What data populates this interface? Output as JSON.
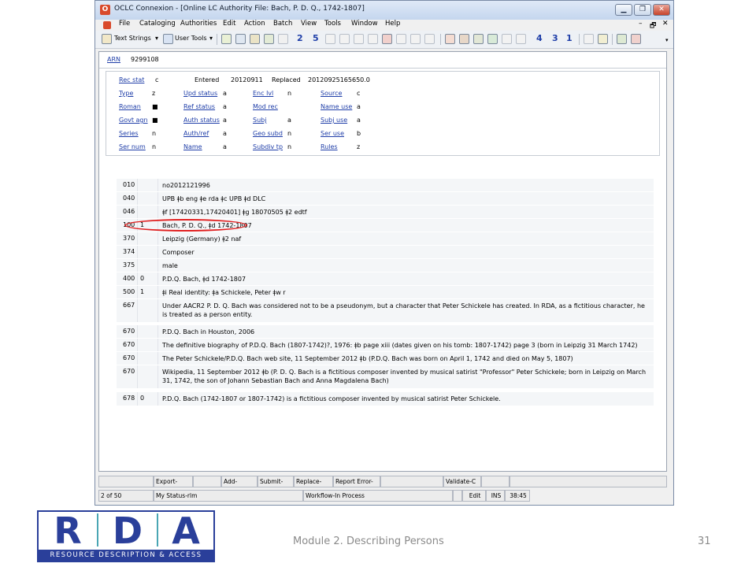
{
  "window": {
    "title": "OCLC Connexion - [Online LC Authority File: Bach, P. D. Q., 1742-1807]",
    "minimize": "▁",
    "restore": "❐",
    "close": "✕"
  },
  "menu": {
    "items": [
      "File",
      "Cataloging",
      "Authorities",
      "Edit",
      "Action",
      "Batch",
      "View",
      "Tools",
      "Window",
      "Help"
    ],
    "mdi_minimize": "–",
    "mdi_restore": "🗗",
    "mdi_close": "✕"
  },
  "toolbar": {
    "text_strings": "Text Strings",
    "user_tools": "User Tools",
    "numbers": [
      "2",
      "5",
      "4",
      "3",
      "1"
    ]
  },
  "record": {
    "arn_label": "ARN",
    "arn_value": "9299108",
    "rec_stat_label": "Rec stat",
    "rec_stat_value": "c",
    "entered_label": "Entered",
    "entered_value": "20120911",
    "replaced_label": "Replaced",
    "replaced_value": "20120925165650.0",
    "fixed_fields": [
      {
        "label": "Type",
        "value": "z"
      },
      {
        "label": "Upd status",
        "value": "a"
      },
      {
        "label": "Enc lvl",
        "value": "n"
      },
      {
        "label": "Source",
        "value": "c"
      },
      {
        "label": "Roman",
        "value": "■"
      },
      {
        "label": "Ref status",
        "value": "a"
      },
      {
        "label": "Mod rec",
        "value": ""
      },
      {
        "label": "Name use",
        "value": "a"
      },
      {
        "label": "Govt agn",
        "value": "■"
      },
      {
        "label": "Auth status",
        "value": "a"
      },
      {
        "label": "Subj",
        "value": "a"
      },
      {
        "label": "Subj use",
        "value": "a"
      },
      {
        "label": "Series",
        "value": "n"
      },
      {
        "label": "Auth/ref",
        "value": "a"
      },
      {
        "label": "Geo subd",
        "value": "n"
      },
      {
        "label": "Ser use",
        "value": "b"
      },
      {
        "label": "Ser num",
        "value": "n"
      },
      {
        "label": "Name",
        "value": "a"
      },
      {
        "label": "Subdiv tp",
        "value": "n"
      },
      {
        "label": "Rules",
        "value": "z"
      }
    ],
    "variable_fields": [
      {
        "tag": "010",
        "ind": "",
        "text": "no2012121996"
      },
      {
        "tag": "040",
        "ind": "",
        "text": "UPB ǂb eng ǂe rda ǂc UPB ǂd DLC"
      },
      {
        "tag": "046",
        "ind": "",
        "text": "ǂf [17420331,17420401] ǂg 18070505 ǂ2 edtf"
      },
      {
        "tag": "100",
        "ind": "1",
        "text": "Bach, P. D. Q., ǂd 1742-1807"
      },
      {
        "tag": "370",
        "ind": "",
        "text": "Leipzig (Germany) ǂ2 naf"
      },
      {
        "tag": "374",
        "ind": "",
        "text": "Composer"
      },
      {
        "tag": "375",
        "ind": "",
        "text": "male"
      },
      {
        "tag": "400",
        "ind": "0",
        "text": "P.D.Q. Bach, ǂd 1742-1807"
      },
      {
        "tag": "500",
        "ind": "1",
        "text": "ǂi Real identity: ǂa Schickele, Peter ǂw r"
      },
      {
        "tag": "667",
        "ind": "",
        "text": "Under AACR2 P. D. Q. Bach was considered not to be a pseudonym, but a character that Peter Schickele has created. In RDA, as a fictitious character, he is treated as a person entity."
      },
      {
        "tag": "670",
        "ind": "",
        "text": "P.D.Q. Bach in Houston, 2006"
      },
      {
        "tag": "670",
        "ind": "",
        "text": "The definitive biography of P.D.Q. Bach (1807-1742)?, 1976: ǂb page xiii (dates given on his tomb: 1807-1742) page 3 (born in Leipzig 31 March 1742)"
      },
      {
        "tag": "670",
        "ind": "",
        "text": "The Peter Schickele/P.D.Q. Bach web site, 11 September 2012 ǂb (P.D.Q. Bach was born on April 1, 1742 and died on May 5, 1807)"
      },
      {
        "tag": "670",
        "ind": "",
        "text": "Wikipedia, 11 September 2012 ǂb (P. D. Q. Bach is a fictitious composer invented by musical satirist \"Professor\" Peter Schickele; born in Leipzig on March 31, 1742, the son of Johann Sebastian Bach and Anna Magdalena Bach)"
      },
      {
        "tag": "678",
        "ind": "0",
        "text": "P.D.Q. Bach (1742-1807 or 1807-1742) is a fictitious composer invented by musical satirist Peter Schickele."
      }
    ]
  },
  "statusbar": {
    "actions": [
      "",
      "Export-",
      "",
      "Add-",
      "Submit-",
      "Replace-",
      "Report Error-",
      "",
      "Validate-C",
      "",
      ""
    ],
    "status": [
      "2 of 50",
      "My Status-rlm",
      "Workflow-In Process",
      "",
      "Edit",
      "INS",
      "38:45"
    ]
  },
  "footer": {
    "logo_letters": [
      "R",
      "D",
      "A"
    ],
    "logo_band": "RESOURCE DESCRIPTION & ACCESS",
    "title": "Module 2. Describing Persons",
    "page": "31"
  },
  "colors": {
    "link_blue": "#1f3ea8",
    "annotation_red": "#e02020",
    "rda_blue": "#2a3f9a"
  }
}
